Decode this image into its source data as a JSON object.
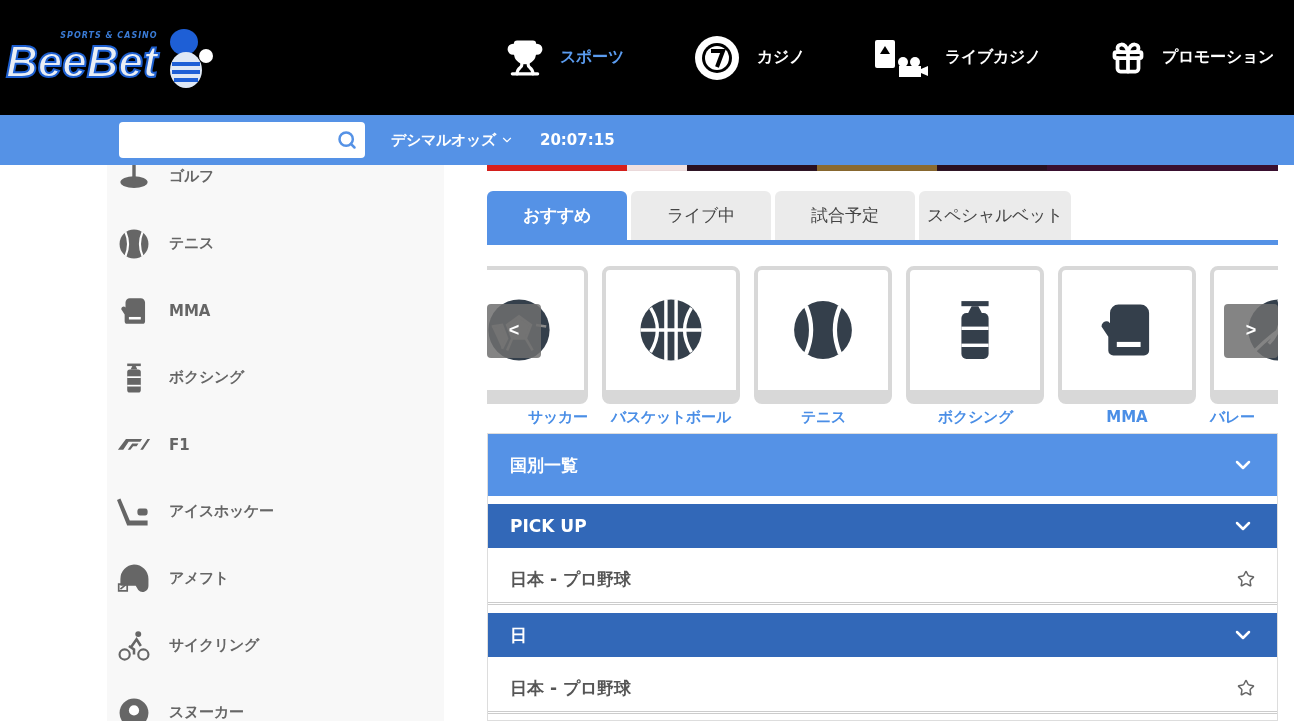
{
  "logo": {
    "tagline": "SPORTS & CASINO",
    "name": "BeeBet"
  },
  "nav": [
    {
      "kind": "trophy",
      "label": "スポーツ",
      "selected": true
    },
    {
      "kind": "chip",
      "label": "カジノ",
      "selected": false
    },
    {
      "kind": "live",
      "label": "ライブカジノ",
      "selected": false
    },
    {
      "kind": "gift",
      "label": "プロモーション",
      "selected": false
    }
  ],
  "toolbar": {
    "odds": "デシマルオッズ",
    "time": "20:07:15"
  },
  "sidebar": {
    "items": [
      {
        "kind": "golf",
        "label": "ゴルフ"
      },
      {
        "kind": "tennis",
        "label": "テニス"
      },
      {
        "kind": "glove",
        "label": "MMA"
      },
      {
        "kind": "bag",
        "label": "ボクシング"
      },
      {
        "kind": "f1",
        "label": "F1"
      },
      {
        "kind": "hockey",
        "label": "アイスホッケー"
      },
      {
        "kind": "helmet",
        "label": "アメフト"
      },
      {
        "kind": "bike",
        "label": "サイクリング"
      },
      {
        "kind": "snooker",
        "label": "スヌーカー"
      }
    ]
  },
  "tabs": [
    {
      "label": "おすすめ",
      "selected": true
    },
    {
      "label": "ライブ中",
      "selected": false
    },
    {
      "label": "試合予定",
      "selected": false
    },
    {
      "label": "スペシャルベット",
      "selected": false
    }
  ],
  "carousel": {
    "prev": "<",
    "next": ">",
    "items": [
      {
        "kind": "soccer",
        "label": "サッカー"
      },
      {
        "kind": "basketball",
        "label": "バスケットボール"
      },
      {
        "kind": "tennis",
        "label": "テニス"
      },
      {
        "kind": "bag",
        "label": "ボクシング"
      },
      {
        "kind": "glove",
        "label": "MMA"
      },
      {
        "kind": "volleyball",
        "label": "バレー"
      }
    ]
  },
  "sections": [
    {
      "kind": "light",
      "title": "国別一覧"
    },
    {
      "kind": "dark",
      "title": "PICK UP",
      "rows": [
        {
          "label": "日本 - プロ野球",
          "starred": false
        }
      ]
    },
    {
      "kind": "dark",
      "title": "日",
      "rows": [
        {
          "label": "日本 - プロ野球",
          "starred": false
        }
      ]
    }
  ]
}
